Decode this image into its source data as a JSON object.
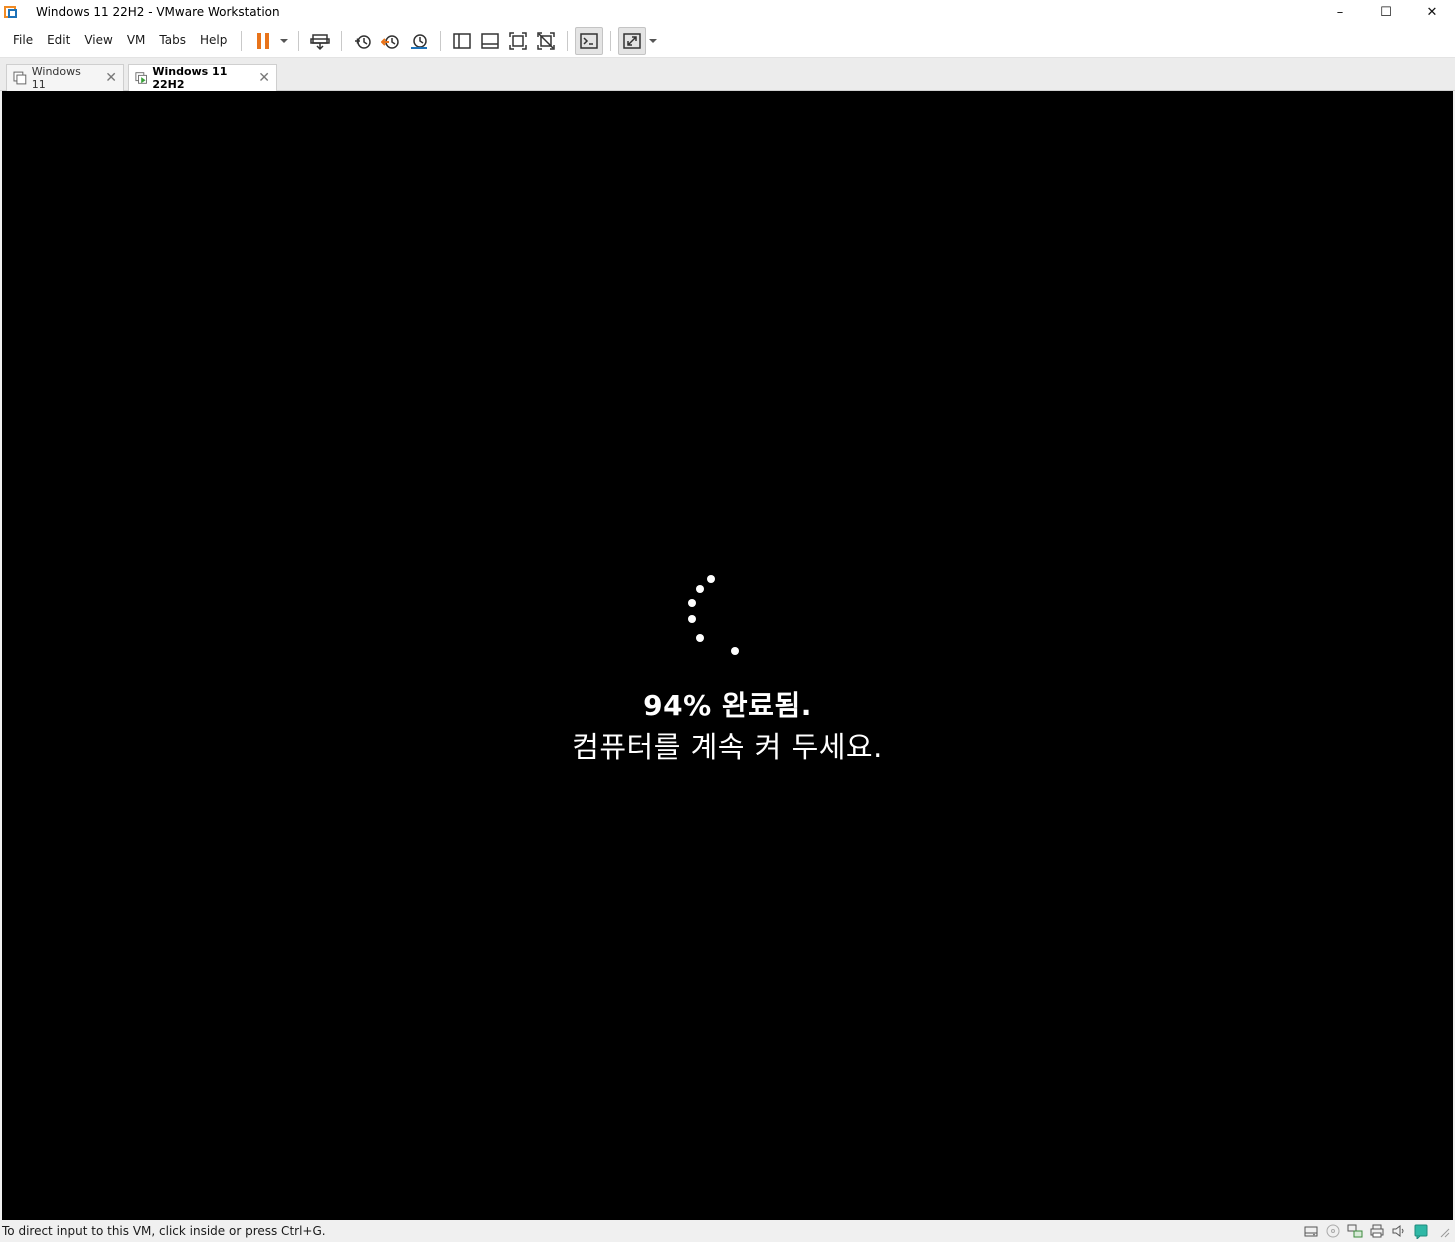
{
  "window": {
    "title": "Windows 11 22H2 - VMware Workstation",
    "controls": {
      "minimize": "–",
      "maximize": "☐",
      "close": "✕"
    }
  },
  "menu": {
    "items": [
      {
        "label": "File"
      },
      {
        "label": "Edit"
      },
      {
        "label": "View"
      },
      {
        "label": "VM"
      },
      {
        "label": "Tabs"
      },
      {
        "label": "Help"
      }
    ]
  },
  "toolbar": {
    "icons": [
      "pause-icon",
      "send-ctrl-alt-del-icon",
      "snapshot-take-icon",
      "snapshot-revert-icon",
      "snapshot-manager-icon",
      "show-library-icon",
      "show-thumbnail-bar-icon",
      "full-screen-icon",
      "unity-icon",
      "console-view-icon",
      "stretch-guest-icon"
    ],
    "accent_orange": "#e8731a",
    "accent_blue": "#1d72b8"
  },
  "tabs": [
    {
      "label": "Windows 11",
      "active": false
    },
    {
      "label": "Windows 11 22H2",
      "active": true
    }
  ],
  "vm": {
    "progress_percent": 94,
    "progress_line": "94% 완료됨.",
    "message_line": "컴퓨터를 계속 켜 두세요.",
    "background": "#000000"
  },
  "statusbar": {
    "text": "To direct input to this VM, click inside or press Ctrl+G.",
    "icons": [
      "hard-disk-icon",
      "cd-dvd-icon",
      "network-adapter-icon",
      "printer-icon",
      "sound-card-icon",
      "message-log-icon"
    ]
  }
}
